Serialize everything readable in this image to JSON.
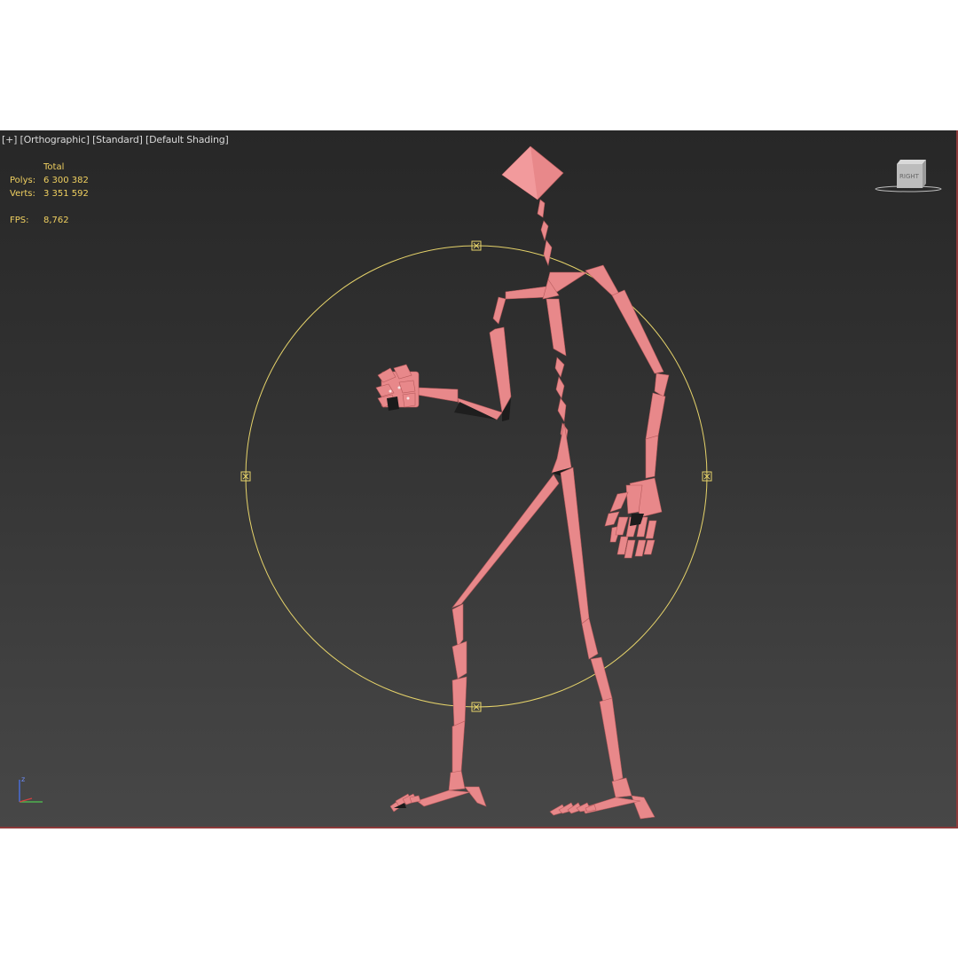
{
  "viewport": {
    "label_plus": "[+]",
    "label_view": "[Orthographic]",
    "label_style": "[Standard]",
    "label_shading": "[Default Shading]",
    "border_color": "#8c3a3a"
  },
  "stats": {
    "header": "Total",
    "polys_label": "Polys:",
    "polys_value": "6 300 382",
    "verts_label": "Verts:",
    "verts_value": "3 351 592",
    "fps_label": "FPS:",
    "fps_value": "8,762",
    "color": "#f0d060"
  },
  "viewcube": {
    "face_label": "RIGHT",
    "icon": "viewcube-icon"
  },
  "scene": {
    "bone_color": "#e8888a",
    "selection_circle_color": "#e6d36a"
  },
  "axis_tripod": {
    "z_label": "z",
    "icon": "axis-tripod-icon"
  }
}
